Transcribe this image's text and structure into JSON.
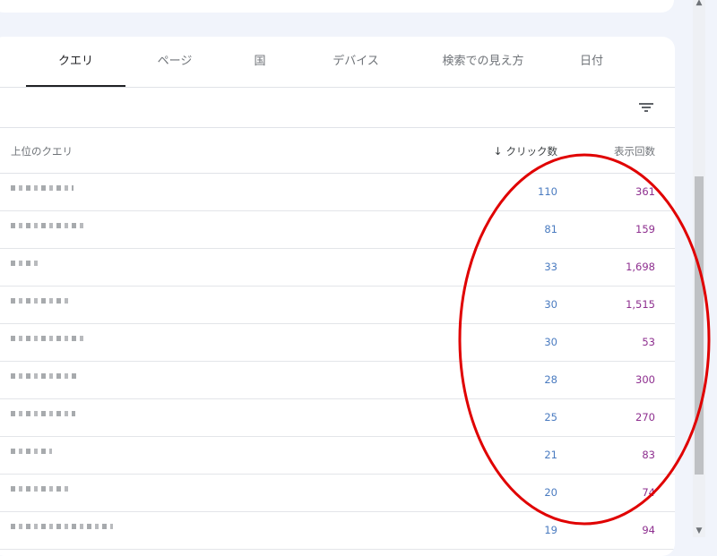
{
  "tabs": [
    {
      "label": "クエリ",
      "active": true
    },
    {
      "label": "ページ",
      "active": false
    },
    {
      "label": "国",
      "active": false
    },
    {
      "label": "デバイス",
      "active": false
    },
    {
      "label": "検索での見え方",
      "active": false
    },
    {
      "label": "日付",
      "active": false
    }
  ],
  "filter": {
    "icon": "filter-icon"
  },
  "table": {
    "headers": {
      "query": "上位のクエリ",
      "clicks": "クリック数",
      "impressions": "表示回数",
      "sort_icon": "arrow-down-icon"
    },
    "rows": [
      {
        "clicks": "110",
        "impressions": "361"
      },
      {
        "clicks": "81",
        "impressions": "159"
      },
      {
        "clicks": "33",
        "impressions": "1,698"
      },
      {
        "clicks": "30",
        "impressions": "1,515"
      },
      {
        "clicks": "30",
        "impressions": "53"
      },
      {
        "clicks": "28",
        "impressions": "300"
      },
      {
        "clicks": "25",
        "impressions": "270"
      },
      {
        "clicks": "21",
        "impressions": "83"
      },
      {
        "clicks": "20",
        "impressions": "74"
      },
      {
        "clicks": "19",
        "impressions": "94"
      }
    ]
  },
  "colors": {
    "clicks": "#4a7bc0",
    "impressions": "#8e2f8f",
    "annotation": "#e00000"
  }
}
